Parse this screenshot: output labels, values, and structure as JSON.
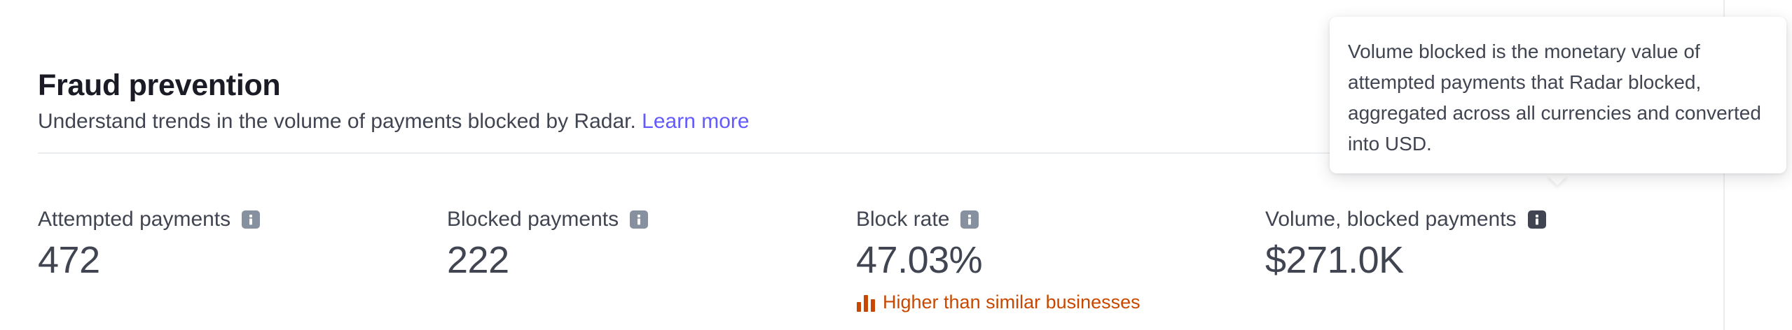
{
  "section": {
    "title": "Fraud prevention",
    "subtitle": "Understand trends in the volume of payments blocked by Radar.",
    "learn_more": "Learn more"
  },
  "metrics": [
    {
      "label": "Attempted payments",
      "value": "472",
      "info_icon": "info-icon"
    },
    {
      "label": "Blocked payments",
      "value": "222",
      "info_icon": "info-icon"
    },
    {
      "label": "Block rate",
      "value": "47.03%",
      "info_icon": "info-icon",
      "comparison": "Higher than similar businesses",
      "comparison_icon": "bar-chart-icon"
    },
    {
      "label": "Volume, blocked payments",
      "value": "$271.0K",
      "info_icon": "info-icon"
    }
  ],
  "tooltip": {
    "text": "Volume blocked is the monetary value of attempted payments that Radar blocked, aggregated across all currencies and converted into USD."
  },
  "colors": {
    "accent": "#635bff",
    "warning": "#c84801",
    "text_primary": "#1a1b25",
    "text_secondary": "#414552",
    "icon_gray": "#87909f"
  }
}
